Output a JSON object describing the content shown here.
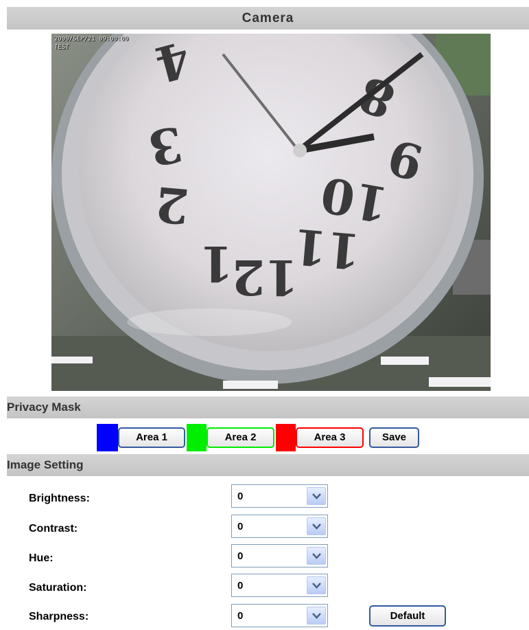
{
  "header": {
    "title": "Camera"
  },
  "camera": {
    "overlay_timestamp": "2009/SEP/21 09:00:00",
    "overlay_name": "TEST"
  },
  "privacy_mask": {
    "title": "Privacy Mask",
    "areas": [
      {
        "label": "Area 1",
        "color": "#0000ff"
      },
      {
        "label": "Area 2",
        "color": "#00ee00"
      },
      {
        "label": "Area 3",
        "color": "#ff0000"
      }
    ],
    "save_label": "Save"
  },
  "image_setting": {
    "title": "Image Setting",
    "rows": [
      {
        "label": "Brightness:",
        "value": "0"
      },
      {
        "label": "Contrast:",
        "value": "0"
      },
      {
        "label": "Hue:",
        "value": "0"
      },
      {
        "label": "Saturation:",
        "value": "0"
      },
      {
        "label": "Sharpness:",
        "value": "0"
      }
    ],
    "default_label": "Default"
  },
  "icons": {
    "select_arrow": "chevron-down-icon"
  }
}
